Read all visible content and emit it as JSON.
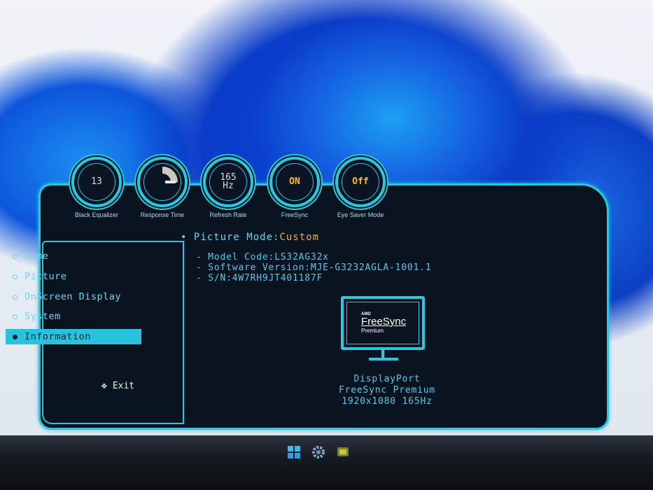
{
  "dials": [
    {
      "label": "Black Equalizer",
      "value": "13"
    },
    {
      "label": "Response Time",
      "value": ""
    },
    {
      "label": "Refresh Rate",
      "value": "165",
      "unit": "Hz"
    },
    {
      "label": "FreeSync",
      "value": "ON"
    },
    {
      "label": "Eye Saver Mode",
      "value": "Off"
    }
  ],
  "picture_mode": {
    "label": "Picture Mode:",
    "value": "Custom"
  },
  "menu": [
    {
      "label": "Game"
    },
    {
      "label": "Picture"
    },
    {
      "label": "OnScreen Display"
    },
    {
      "label": "System"
    },
    {
      "label": "Information",
      "selected": true
    }
  ],
  "exit_label": "Exit",
  "info": {
    "model": "- Model Code:LS32AG32x",
    "software": "- Software Version:MJE-G3232AGLA-1001.1",
    "sn": "- S/N:4W7RH9JT401187F"
  },
  "logo": {
    "brand": "AMD",
    "name": "FreeSync",
    "tier": "Premium"
  },
  "connection": {
    "port": "DisplayPort",
    "sync": "FreeSync Premium",
    "mode": "1920x1080 165Hz"
  },
  "colors": {
    "accent": "#29c6e0",
    "value": "#f0b020",
    "panel": "#0a1320"
  }
}
